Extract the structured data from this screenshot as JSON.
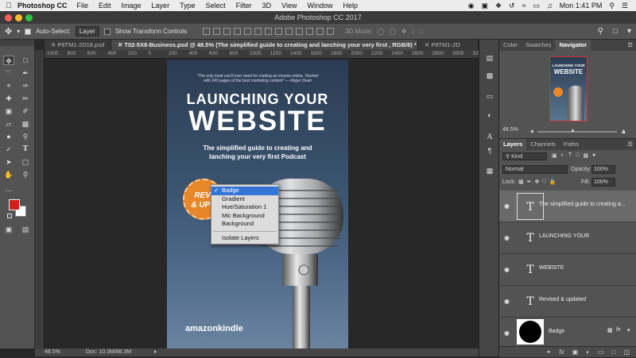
{
  "menubar": {
    "app_name": "Photoshop CC",
    "items": [
      "File",
      "Edit",
      "Image",
      "Layer",
      "Type",
      "Select",
      "Filter",
      "3D",
      "View",
      "Window",
      "Help"
    ],
    "clock": "Mon 1:41 PM"
  },
  "window": {
    "title": "Adobe Photoshop CC 2017"
  },
  "options": {
    "auto_select_label": "Auto-Select:",
    "auto_select_value": "Layer",
    "show_transform_label": "Show Transform Controls",
    "mode_3d": "3D Mode:"
  },
  "tabs": [
    {
      "label": "P8TM1-2D18.psd"
    },
    {
      "label": "T02-5X8-Business.psd @ 48.5% (The simplified guide to creating and  lanching your very first , RGB/8) *"
    },
    {
      "label": "P8TM1-2D"
    }
  ],
  "ruler_ticks": [
    "1000",
    "800",
    "600",
    "400",
    "200",
    "0",
    "200",
    "400",
    "600",
    "800",
    "1000",
    "1200",
    "1400",
    "1600",
    "1800",
    "2000",
    "2200",
    "2400",
    "2600",
    "2800",
    "3000",
    "3200"
  ],
  "document": {
    "quote_line1": "\"The only book you'll ever need for making an income online. Packed",
    "quote_line2": "with 240 pages of the best marketing content\" — Roger Dean",
    "title_line1": "LAUNCHING YOUR",
    "title_line2": "WEBSITE",
    "subtitle_line1": "The simplified guide to creating and",
    "subtitle_line2": "lanching your very first Podcast",
    "badge_line1": "REVI",
    "badge_line2": "& UPD",
    "brand": "amazonkindle"
  },
  "context_menu": {
    "items": [
      "Badge",
      "Gradient",
      "Hue/Saturation 1",
      "Mic Background",
      "Background"
    ],
    "selected": "Badge",
    "extra": "Isolate Layers"
  },
  "status": {
    "zoom": "48.5%",
    "doc": "Doc: 10.3M/86.3M"
  },
  "navigator": {
    "tabs": [
      "Color",
      "Swatches",
      "Navigator"
    ],
    "thumb_title_line1": "LAUNCHING YOUR",
    "thumb_title_line2": "WEBSITE",
    "zoom": "48.5%"
  },
  "layers_panel": {
    "tabs": [
      "Layers",
      "Channels",
      "Paths"
    ],
    "filter_kind": "Kind",
    "blend_mode": "Normal",
    "opacity_label": "Opacity:",
    "opacity_value": "100%",
    "lock_label": "Lock:",
    "fill_label": "Fill:",
    "fill_value": "100%",
    "layers": [
      {
        "name": "The simplified guide to creating a...",
        "type_glyph": "T",
        "selected": true
      },
      {
        "name": "LAUNCHING YOUR",
        "type_glyph": "T",
        "selected": false
      },
      {
        "name": "WEBSITE",
        "type_glyph": "T",
        "selected": false
      },
      {
        "name": "Revised & updated",
        "type_glyph": "T",
        "selected": false
      },
      {
        "name": "Badge",
        "type_glyph": "",
        "fx": "fx",
        "selected": false
      }
    ]
  },
  "colors": {
    "foreground": "#d0201c",
    "background": "#ffffff",
    "highlight": "#3476d8",
    "badge": "#e8862a"
  }
}
